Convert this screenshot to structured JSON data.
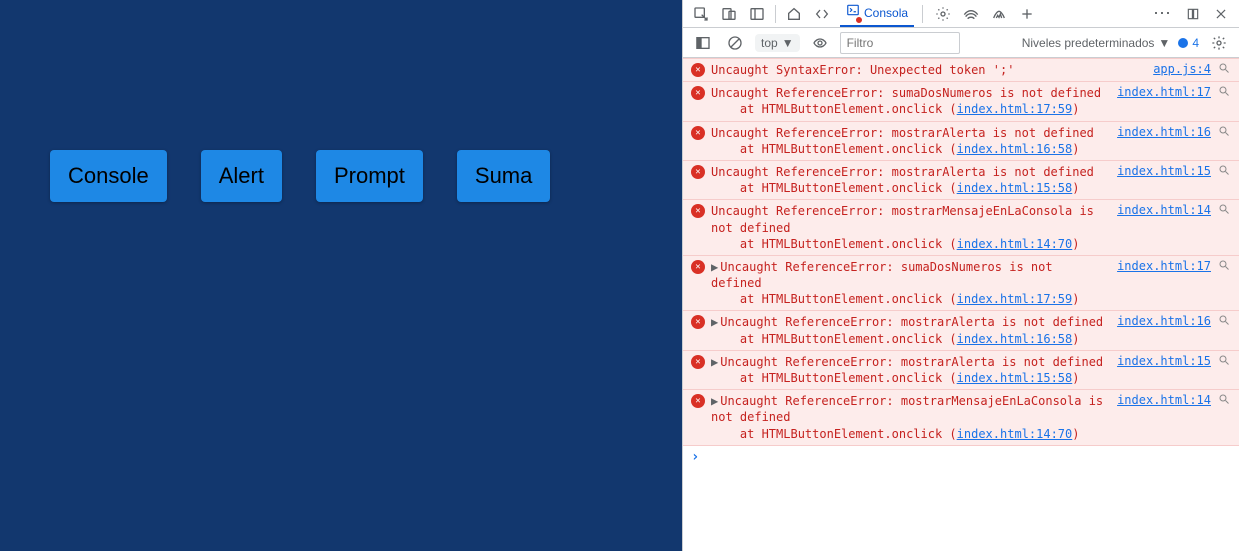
{
  "page": {
    "buttons": [
      "Console",
      "Alert",
      "Prompt",
      "Suma"
    ]
  },
  "toolbar": {
    "tab_label": "Consola",
    "context": "top",
    "filter_placeholder": "Filtro",
    "levels_label": "Niveles predeterminados",
    "issue_count": "4"
  },
  "errors": [
    {
      "collapsed": false,
      "msg1": "Uncaught SyntaxError: Unexpected token ';'",
      "msg2": "",
      "inner_link": "",
      "source": "app.js:4"
    },
    {
      "collapsed": false,
      "msg1": "Uncaught ReferenceError: sumaDosNumeros is not defined",
      "msg2": "    at HTMLButtonElement.onclick (",
      "inner_link": "index.html:17:59",
      "source": "index.html:17"
    },
    {
      "collapsed": false,
      "msg1": "Uncaught ReferenceError: mostrarAlerta is not defined",
      "msg2": "    at HTMLButtonElement.onclick (",
      "inner_link": "index.html:16:58",
      "source": "index.html:16"
    },
    {
      "collapsed": false,
      "msg1": "Uncaught ReferenceError: mostrarAlerta is not defined",
      "msg2": "    at HTMLButtonElement.onclick (",
      "inner_link": "index.html:15:58",
      "source": "index.html:15"
    },
    {
      "collapsed": false,
      "msg1": "Uncaught ReferenceError: mostrarMensajeEnLaConsola is not defined",
      "msg2": "    at HTMLButtonElement.onclick (",
      "inner_link": "index.html:14:70",
      "source": "index.html:14"
    },
    {
      "collapsed": true,
      "msg1": "Uncaught ReferenceError: sumaDosNumeros is not defined",
      "msg2": "    at HTMLButtonElement.onclick (",
      "inner_link": "index.html:17:59",
      "source": "index.html:17"
    },
    {
      "collapsed": true,
      "msg1": "Uncaught ReferenceError: mostrarAlerta is not defined",
      "msg2": "    at HTMLButtonElement.onclick (",
      "inner_link": "index.html:16:58",
      "source": "index.html:16"
    },
    {
      "collapsed": true,
      "msg1": "Uncaught ReferenceError: mostrarAlerta is not defined",
      "msg2": "    at HTMLButtonElement.onclick (",
      "inner_link": "index.html:15:58",
      "source": "index.html:15"
    },
    {
      "collapsed": true,
      "msg1": "Uncaught ReferenceError: mostrarMensajeEnLaConsola is not defined",
      "msg2": "    at HTMLButtonElement.onclick (",
      "inner_link": "index.html:14:70",
      "source": "index.html:14"
    }
  ]
}
